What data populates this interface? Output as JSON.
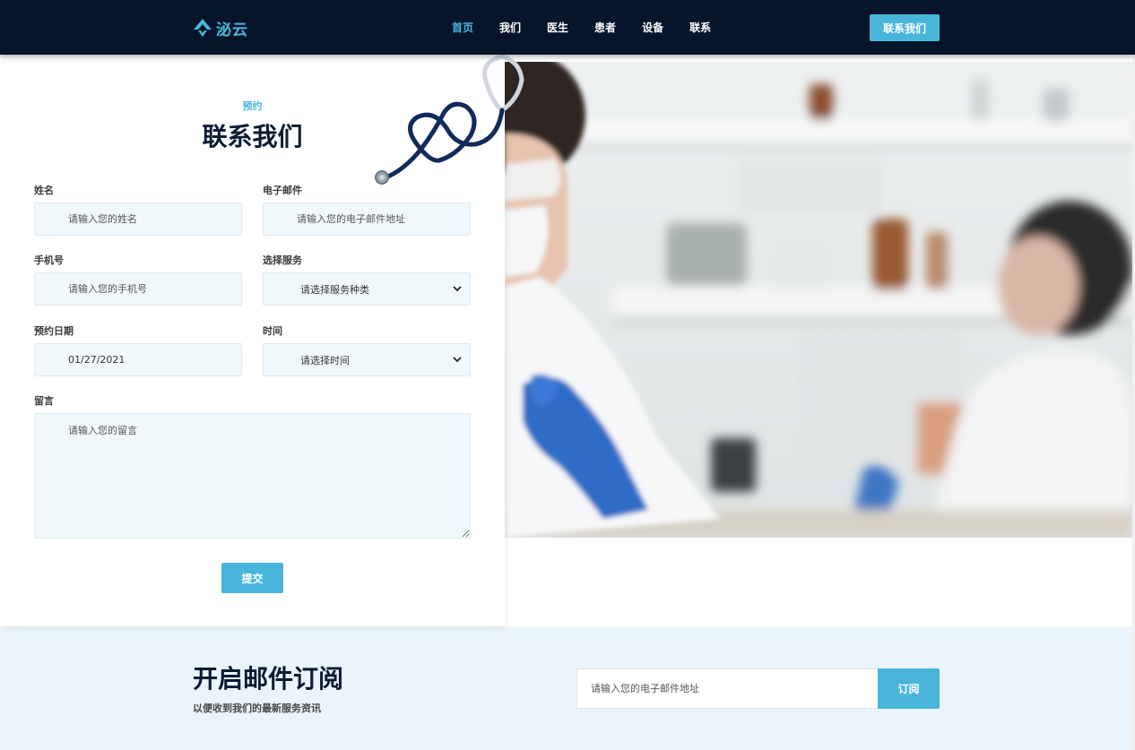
{
  "nav": {
    "logo_text": "泌云",
    "links": [
      "首页",
      "我们",
      "医生",
      "患者",
      "设备",
      "联系"
    ],
    "active_index": 0,
    "cta_label": "联系我们"
  },
  "form": {
    "eyebrow": "预约",
    "title": "联系我们",
    "name": {
      "label": "姓名",
      "placeholder": "请输入您的姓名"
    },
    "email": {
      "label": "电子邮件",
      "placeholder": "请输入您的电子邮件地址"
    },
    "phone": {
      "label": "手机号",
      "placeholder": "请输入您的手机号"
    },
    "service": {
      "label": "选择服务",
      "selected": "请选择服务种类"
    },
    "date": {
      "label": "预约日期",
      "value": "01/27/2021"
    },
    "time": {
      "label": "时间",
      "selected": "请选择时间"
    },
    "message": {
      "label": "留言",
      "placeholder": "请输入您的留言"
    },
    "submit_label": "提交"
  },
  "subscribe": {
    "title": "开启邮件订阅",
    "description": "以便收到我们的最新服务资讯",
    "placeholder": "请输入您的电子邮件地址",
    "button_label": "订阅"
  },
  "colors": {
    "accent": "#49b5da",
    "navbar_bg": "#061529",
    "heading": "#0c1b33",
    "field_bg": "#f1f8fb",
    "subscribe_bg": "#eaf4fa"
  },
  "icons": {
    "logo": "mountain-logo-icon",
    "select_arrow": "chevron-down-icon",
    "decoration": "stethoscope-icon"
  }
}
